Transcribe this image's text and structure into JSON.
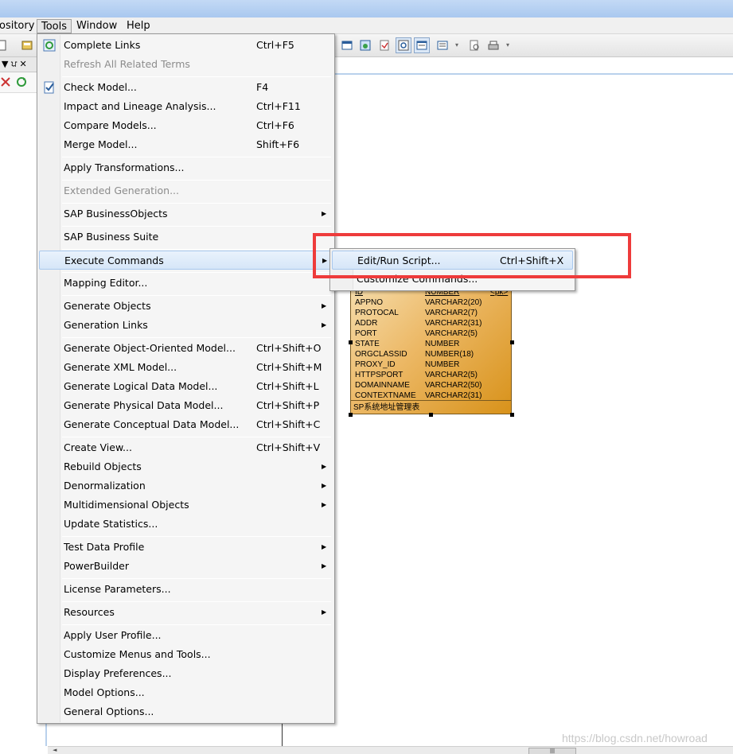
{
  "menubar": {
    "items": [
      {
        "label": "ository"
      },
      {
        "label": "Tools"
      },
      {
        "label": "Window"
      },
      {
        "label": "Help"
      }
    ]
  },
  "tools_menu": {
    "items": [
      {
        "label": "Complete Links",
        "shortcut": "Ctrl+F5",
        "icon": "complete-links-icon"
      },
      {
        "label": "Refresh All Related Terms",
        "shortcut": ""
      },
      {
        "label": "Check Model...",
        "shortcut": "F4",
        "icon": "check-model-icon"
      },
      {
        "label": "Impact and Lineage Analysis...",
        "shortcut": "Ctrl+F11"
      },
      {
        "label": "Compare Models...",
        "shortcut": "Ctrl+F6"
      },
      {
        "label": "Merge Model...",
        "shortcut": "Shift+F6"
      },
      {
        "label": "Apply Transformations...",
        "shortcut": ""
      },
      {
        "label": "Extended Generation...",
        "shortcut": ""
      },
      {
        "label": "SAP BusinessObjects",
        "shortcut": ""
      },
      {
        "label": "SAP Business Suite",
        "shortcut": ""
      },
      {
        "label": "Execute Commands",
        "shortcut": ""
      },
      {
        "label": "Mapping Editor...",
        "shortcut": ""
      },
      {
        "label": "Generate Objects",
        "shortcut": ""
      },
      {
        "label": "Generation Links",
        "shortcut": ""
      },
      {
        "label": "Generate Object-Oriented Model...",
        "shortcut": "Ctrl+Shift+O"
      },
      {
        "label": "Generate XML Model...",
        "shortcut": "Ctrl+Shift+M"
      },
      {
        "label": "Generate Logical Data Model...",
        "shortcut": "Ctrl+Shift+L"
      },
      {
        "label": "Generate Physical Data Model...",
        "shortcut": "Ctrl+Shift+P"
      },
      {
        "label": "Generate Conceptual Data Model...",
        "shortcut": "Ctrl+Shift+C"
      },
      {
        "label": "Create View...",
        "shortcut": "Ctrl+Shift+V"
      },
      {
        "label": "Rebuild Objects",
        "shortcut": ""
      },
      {
        "label": "Denormalization",
        "shortcut": ""
      },
      {
        "label": "Multidimensional Objects",
        "shortcut": ""
      },
      {
        "label": "Update Statistics...",
        "shortcut": ""
      },
      {
        "label": "Test Data Profile",
        "shortcut": ""
      },
      {
        "label": "PowerBuilder",
        "shortcut": ""
      },
      {
        "label": "License Parameters...",
        "shortcut": ""
      },
      {
        "label": "Resources",
        "shortcut": ""
      },
      {
        "label": "Apply User Profile...",
        "shortcut": ""
      },
      {
        "label": "Customize Menus and Tools...",
        "shortcut": ""
      },
      {
        "label": "Display Preferences...",
        "shortcut": ""
      },
      {
        "label": "Model Options...",
        "shortcut": ""
      },
      {
        "label": "General Options...",
        "shortcut": ""
      }
    ]
  },
  "execute_submenu": {
    "items": [
      {
        "label": "Edit/Run Script...",
        "shortcut": "Ctrl+Shift+X"
      },
      {
        "label": "Customize Commands...",
        "shortcut": ""
      }
    ]
  },
  "entity": {
    "rows": [
      {
        "name": "ID",
        "type": "NUMBER",
        "key": "<pk>"
      },
      {
        "name": "APPNO",
        "type": "VARCHAR2(20)",
        "key": ""
      },
      {
        "name": "PROTOCAL",
        "type": "VARCHAR2(7)",
        "key": ""
      },
      {
        "name": "ADDR",
        "type": "VARCHAR2(31)",
        "key": ""
      },
      {
        "name": "PORT",
        "type": "VARCHAR2(5)",
        "key": ""
      },
      {
        "name": "STATE",
        "type": "NUMBER",
        "key": ""
      },
      {
        "name": "ORGCLASSID",
        "type": "NUMBER(18)",
        "key": ""
      },
      {
        "name": "PROXY_ID",
        "type": "NUMBER",
        "key": ""
      },
      {
        "name": "HTTPSPORT",
        "type": "VARCHAR2(5)",
        "key": ""
      },
      {
        "name": "DOMAINNAME",
        "type": "VARCHAR2(50)",
        "key": ""
      },
      {
        "name": "CONTEXTNAME",
        "type": "VARCHAR2(31)",
        "key": ""
      }
    ],
    "comment": "SP系统地址管理表"
  },
  "left_panel": {
    "pin_glyph": "▼ ਪ ✕"
  },
  "scrollbar": {
    "thumb_glyph": "|||",
    "arrow": "◄"
  },
  "watermark": "https://blog.csdn.net/howroad",
  "colors": {
    "highlight_box": "#ee3b3b",
    "entity_fill": "#ecb865",
    "menu_highlight": "#d6e6f8"
  }
}
